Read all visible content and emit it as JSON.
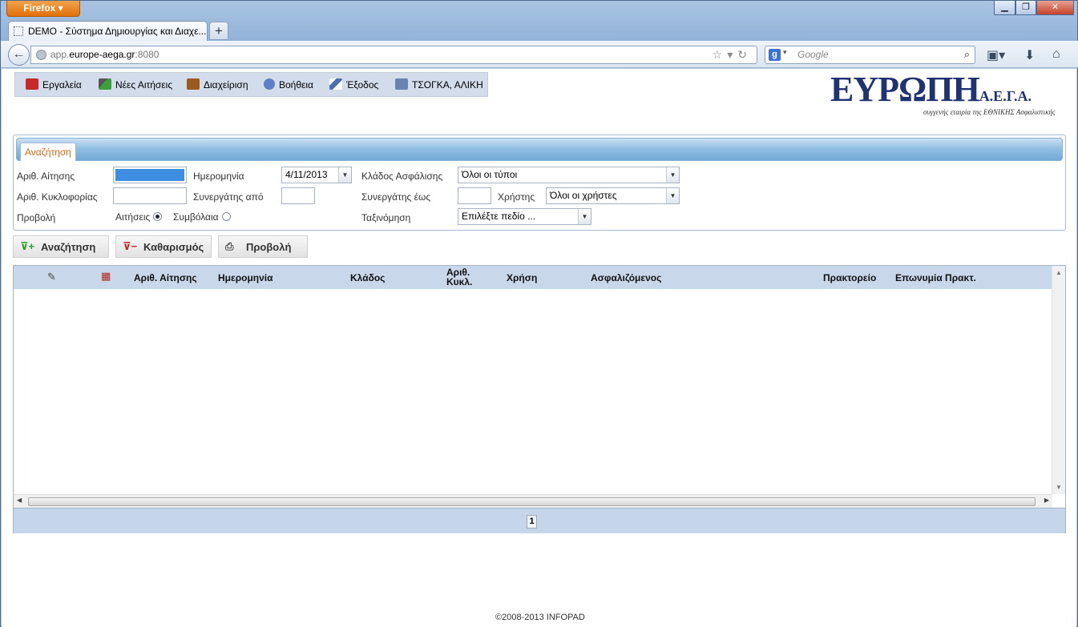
{
  "browser": {
    "menu_button": "Firefox",
    "tab_title": "DEMO - Σύστημα Δημιουργίας και Διαχε...",
    "url_prefix": "app.",
    "url_domain": "europe-aega.gr",
    "url_suffix": ":8080",
    "search_placeholder": "Google"
  },
  "menu": {
    "items": [
      {
        "label": "Εργαλεία",
        "icon": "toolbox-icon"
      },
      {
        "label": "Νέες Αιτήσεις",
        "icon": "wand-plus-icon"
      },
      {
        "label": "Διαχείριση",
        "icon": "briefcase-icon"
      },
      {
        "label": "Βοήθεια",
        "icon": "help-icon"
      },
      {
        "label": "Έξοδος",
        "icon": "pen-icon"
      },
      {
        "label": "ΤΣΟΓΚΑ, ΑΛΙΚΗ",
        "icon": "user-card-icon"
      }
    ]
  },
  "logo": {
    "big": "ΕΥΡΩΠΗ",
    "small": "Α.Ε.Γ.Α.",
    "subtitle": "συγγενής εταιρία της ΕΘΝΙΚΗΣ Ασφαλιστικής"
  },
  "search": {
    "tab_label": "Αναζήτηση",
    "app_no_label": "Αριθ. Αίτησης",
    "app_no_value": "",
    "date_label": "Ημερομηνία",
    "date_value": "4/11/2013",
    "branch_label": "Κλάδος Ασφάλισης",
    "branch_value": "Όλοι οι τύποι",
    "plate_label": "Αριθ. Κυκλοφορίας",
    "plate_value": "",
    "partner_from_label": "Συνεργάτης από",
    "partner_from_value": "",
    "partner_to_label": "Συνεργάτης έως",
    "partner_to_value": "",
    "user_label": "Χρήστης",
    "user_value": "Όλοι οι χρήστες",
    "view_label": "Προβολή",
    "radio_applications": "Αιτήσεις",
    "radio_contracts": "Συμβόλαια",
    "sort_label": "Ταξινόμηση",
    "sort_value": "Επιλέξτε πεδίο ..."
  },
  "actions": {
    "search": "Αναζήτηση",
    "clear": "Καθαρισμός",
    "view": "Προβολή"
  },
  "grid": {
    "columns": [
      "Αριθ. Αίτησης",
      "Ημερομηνία",
      "Κλάδος",
      "Αριθ. Κυκλ.",
      "Χρήση",
      "Ασφαλιζόμενος",
      "Πρακτορείο",
      "Επωνυμία Πρακτ."
    ],
    "current_page": "1"
  },
  "footer": "©2008-2013 INFOPAD"
}
